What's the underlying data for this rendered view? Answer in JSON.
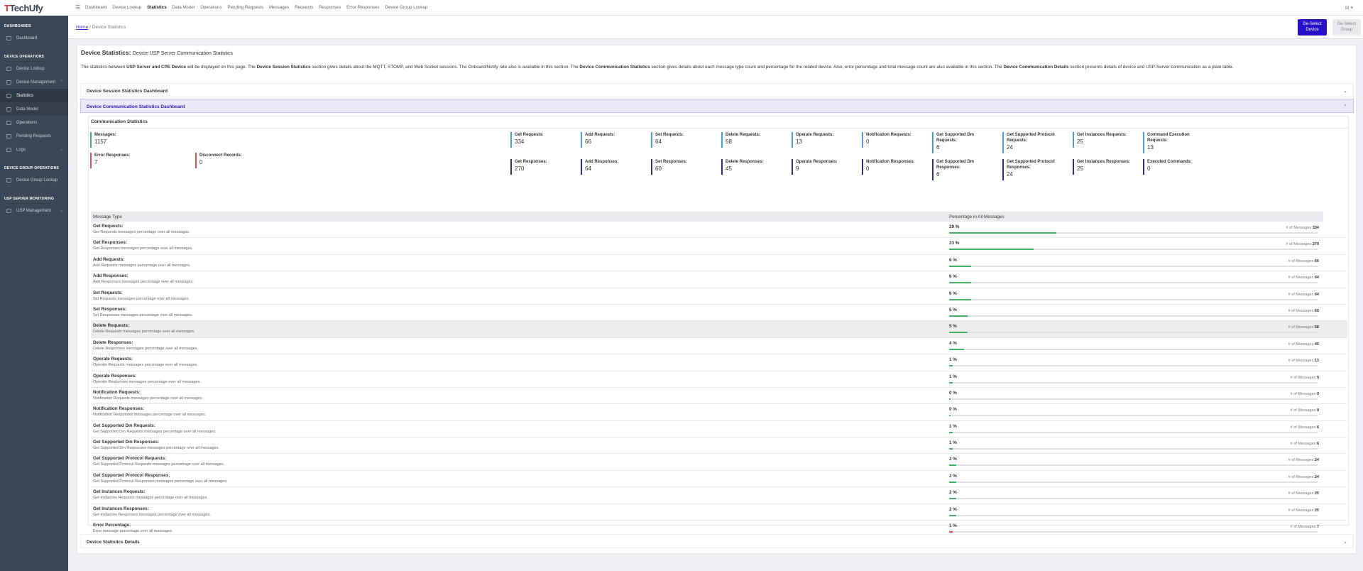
{
  "logo": {
    "text_prefix": "T",
    "text_rest": "TechUfy"
  },
  "sidebar": {
    "sections": [
      {
        "title": "DASHBOARDS",
        "items": [
          {
            "label": "Dashboard"
          }
        ]
      },
      {
        "title": "DEVICE OPERATIONS",
        "items": [
          {
            "label": "Device Lookup"
          },
          {
            "label": "Device Management"
          },
          {
            "label": "Statistics"
          },
          {
            "label": "Data Model"
          },
          {
            "label": "Operations"
          },
          {
            "label": "Pending Requests"
          },
          {
            "label": "Logs"
          }
        ]
      },
      {
        "title": "DEVICE GROUP OPERATIONS",
        "items": [
          {
            "label": "Device Group Lookup"
          }
        ]
      },
      {
        "title": "USP SERVER MONITORING",
        "items": [
          {
            "label": "USP Management"
          }
        ]
      }
    ]
  },
  "topnav": [
    "Dashboard",
    "Device Lookup",
    "Statistics",
    "Data Model",
    "Operations",
    "Pending Requests",
    "Messages",
    "Requests",
    "Responses",
    "Error Responses",
    "Device Group Lookup"
  ],
  "breadcrumb": {
    "home": "Home",
    "separator": "/",
    "current": "Device Statistics"
  },
  "buttons": {
    "deselect_device_l1": "De-Select",
    "deselect_device_l2": "Device",
    "deselect_group_l1": "De-Select",
    "deselect_group_l2": "Group"
  },
  "page": {
    "title": "Device Statistics:",
    "subtitle": "Device-USP Server Communication Statistics",
    "desc": {
      "p1": "The statistics between ",
      "b1": "USP Server and CPE Device",
      "p2": " will be displayed on this page. The ",
      "b2": "Device Session Statistics",
      "p3": " section gives details about the MQTT, STOMP, and Web Socket sessions. The Onboard/Notify rate also is available in this section. The ",
      "b3": "Device Communication Statistics",
      "p4": " section gives details about each message type count and percentage for the related device. Also, error percentage and total message count are also available in this section. The ",
      "b4": "Device Communication Details",
      "p5": " section presents details of device and USP-Server communication as a plain table."
    }
  },
  "accordions": {
    "session": "Device Session Statistics Dashboard",
    "communication": "Device Communication Statistics Dashboard",
    "details": "Device Statistics Details"
  },
  "comm_stats": {
    "title": "Communication Statistics",
    "messages": {
      "label": "Messages:",
      "value": "1157"
    },
    "error_responses": {
      "label": "Error Responses:",
      "value": "7"
    },
    "disconnect_records": {
      "label": "Disconnect Records:",
      "value": "0"
    },
    "requests": [
      {
        "label": "Get Requests:",
        "value": "334"
      },
      {
        "label": "Add Requests:",
        "value": "66"
      },
      {
        "label": "Set Requests:",
        "value": "64"
      },
      {
        "label": "Delete Requests:",
        "value": "58"
      },
      {
        "label": "Operate Requests:",
        "value": "13"
      },
      {
        "label": "Notification Requests:",
        "value": "0"
      },
      {
        "label": "Get Supported Dm Requests:",
        "value": "6"
      },
      {
        "label": "Get Supported Protocol Requests:",
        "value": "24"
      },
      {
        "label": "Get Instances Requests:",
        "value": "25"
      },
      {
        "label": "Command Execution Requests:",
        "value": "13"
      }
    ],
    "responses": [
      {
        "label": "Get Responses:",
        "value": "270"
      },
      {
        "label": "Add Responses:",
        "value": "64"
      },
      {
        "label": "Set Responses:",
        "value": "60"
      },
      {
        "label": "Delete Responses:",
        "value": "45"
      },
      {
        "label": "Operate Responses:",
        "value": "9"
      },
      {
        "label": "Notification Responses:",
        "value": "0"
      },
      {
        "label": "Get Supported Dm Responses:",
        "value": "6"
      },
      {
        "label": "Get Supported Protocol Responses:",
        "value": "24"
      },
      {
        "label": "Get Instances Responses:",
        "value": "25"
      },
      {
        "label": "Executed Commands:",
        "value": "0"
      }
    ]
  },
  "table": {
    "col_type": "Message Type",
    "col_pct": "Percentage in All Messages",
    "count_prefix": "# of Messages:",
    "rows": [
      {
        "name": "Get Requests:",
        "sub": "Get Requests messages percentage over all messages.",
        "pct_text": "29 %",
        "pct": 29,
        "count": "334"
      },
      {
        "name": "Get Responses:",
        "sub": "Get Responses messages percentage over all messages.",
        "pct_text": "23 %",
        "pct": 23,
        "count": "270"
      },
      {
        "name": "Add Requests:",
        "sub": "Add Requests messages percentage over all messages.",
        "pct_text": "6 %",
        "pct": 6,
        "count": "66"
      },
      {
        "name": "Add Responses:",
        "sub": "Add Responses messages percentage over all messages.",
        "pct_text": "6 %",
        "pct": 6,
        "count": "64"
      },
      {
        "name": "Set Requests:",
        "sub": "Set Requests messages percentage over all messages.",
        "pct_text": "6 %",
        "pct": 6,
        "count": "64"
      },
      {
        "name": "Set Responses:",
        "sub": "Set Responses messages percentage over all messages.",
        "pct_text": "5 %",
        "pct": 5,
        "count": "60"
      },
      {
        "name": "Delete Requests:",
        "sub": "Delete Requests messages percentage over all messages.",
        "pct_text": "5 %",
        "pct": 5,
        "count": "58"
      },
      {
        "name": "Delete Responses:",
        "sub": "Delete Responses messages percentage over all messages.",
        "pct_text": "4 %",
        "pct": 4,
        "count": "45"
      },
      {
        "name": "Operate Requests:",
        "sub": "Operate Requests messages percentage over all messages.",
        "pct_text": "1 %",
        "pct": 1,
        "count": "13"
      },
      {
        "name": "Operate Responses:",
        "sub": "Operate Responses messages percentage over all messages.",
        "pct_text": "1 %",
        "pct": 1,
        "count": "9"
      },
      {
        "name": "Notification Requests:",
        "sub": "Notification Requests messages percentage over all messages.",
        "pct_text": "0 %",
        "pct": 0,
        "count": "0"
      },
      {
        "name": "Notification Responses:",
        "sub": "Notification Responses messages percentage over all messages.",
        "pct_text": "0 %",
        "pct": 0,
        "count": "0"
      },
      {
        "name": "Get Supported Dm Requests:",
        "sub": "Get Supported Dm Requests messages percentage over all messages.",
        "pct_text": "1 %",
        "pct": 1,
        "count": "6"
      },
      {
        "name": "Get Supported Dm Responses:",
        "sub": "Get Supported Dm Responses messages percentage over all messages.",
        "pct_text": "1 %",
        "pct": 1,
        "count": "6"
      },
      {
        "name": "Get Supported Protocol Requests:",
        "sub": "Get Supported Protocol Requests messages percentage over all messages.",
        "pct_text": "2 %",
        "pct": 2,
        "count": "24"
      },
      {
        "name": "Get Supported Protocol Responses:",
        "sub": "Get Supported Protocol Responses messages percentage over all messages.",
        "pct_text": "2 %",
        "pct": 2,
        "count": "24"
      },
      {
        "name": "Get Instances Requests:",
        "sub": "Get Instances Requests messages percentage over all messages.",
        "pct_text": "2 %",
        "pct": 2,
        "count": "25"
      },
      {
        "name": "Get Instances Responses:",
        "sub": "Get Instances Responses messages percentage over all messages.",
        "pct_text": "2 %",
        "pct": 2,
        "count": "25"
      },
      {
        "name": "Error Percentage:",
        "sub": "Error message percentage over all messages.",
        "pct_text": "1 %",
        "pct": 1,
        "count": "7",
        "error": true
      }
    ]
  }
}
